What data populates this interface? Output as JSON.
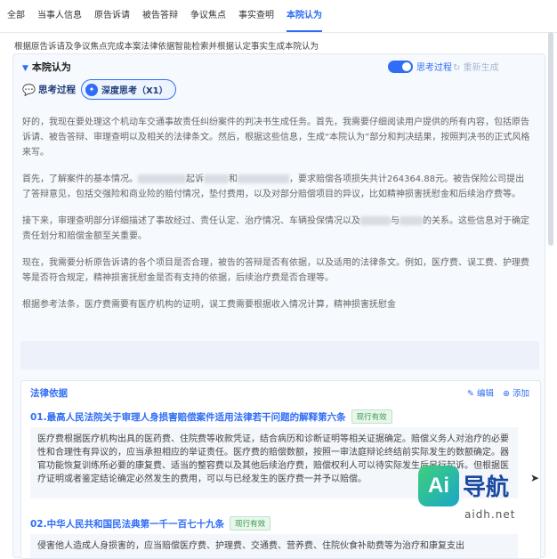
{
  "tabs": [
    "全部",
    "当事人信息",
    "原告诉请",
    "被告答辩",
    "争议焦点",
    "事实查明",
    "本院认为"
  ],
  "active_tab": "本院认为",
  "subtitle": "根据原告诉请及争议焦点完成本案法律依据智能检索并根据认定事实生成本院认为",
  "panel": {
    "title": "本院认为",
    "toggle_label": "思考过程",
    "toggle_on": true,
    "regenerate_label": "重新生成",
    "thinking_label": "思考过程",
    "deep_button_label": "深度思考（X1）"
  },
  "thinking": {
    "p1": "好的，我现在要处理这个机动车交通事故责任纠纷案件的判决书生成任务。首先，我需要仔细阅读用户提供的所有内容，包括原告诉请、被告答辩、审理查明以及相关的法律条文。然后，根据这些信息，生成“本院认为”部分和判决结果，按照判决书的正式风格来写。",
    "p2a": "首先，了解案件的基本情况。",
    "p2b": "起诉",
    "p2c": "和",
    "p2d": "，要求赔偿各项损失共计264364.88元。被告保险公司提出了答辩意见，包括交强险和商业险的赔付情况，垫付费用，以及对部分赔偿项目的异议，比如精神损害抚慰金和后续治疗费等。",
    "p3a": "接下来，审理查明部分详细描述了事故经过、责任认定、治疗情况、车辆投保情况以及",
    "p3b": "与",
    "p3c": "的关系。这些信息对于确定责任划分和赔偿金额至关重要。",
    "p4": "现在，我需要分析原告诉请的各个项目是否合理，被告的答辩是否有依据，以及适用的法律条文。例如，医疗费、误工费、护理费等是否符合规定，精神损害抚慰金是否有支持的依据，后续治疗费是否合理等。",
    "p5": "根据参考法条，医疗费需要有医疗机构的证明，误工费需要根据收入情况计算，精神损害抚慰金"
  },
  "laws": {
    "section_title": "法律依据",
    "edit_label": "编辑",
    "add_label": "添加",
    "items": [
      {
        "title": "01.最高人民法院关于审理人身损害赔偿案件适用法律若干问题的解释第六条",
        "status": "现行有效",
        "text": "医疗费根据医疗机构出具的医药费、住院费等收款凭证，结合病历和诊断证明等相关证据确定。赔偿义务人对治疗的必要性和合理性有异议的，应当承担相应的举证责任。医疗费的赔偿数额，按照一审法庭辩论终结前实际发生的数额确定。器官功能恢复训练所必要的康复费、适当的整容费以及其他后续治疗费，赔偿权利人可以待实际发生后另行起诉。但根据医疗证明或者鉴定结论确定必然发生的费用，可以与已经发生的医疗费一并予以赔偿。"
      },
      {
        "title": "02.中华人民共和国民法典第一千一百七十九条",
        "status": "现行有效",
        "text": "侵害他人造成人身损害的，应当赔偿医疗费、护理费、交通费、营养费、住院伙食补助费等为治疗和康复支出"
      }
    ]
  },
  "watermark": {
    "ai": "Ai",
    "nav": "导航",
    "url": "aidh.net"
  }
}
